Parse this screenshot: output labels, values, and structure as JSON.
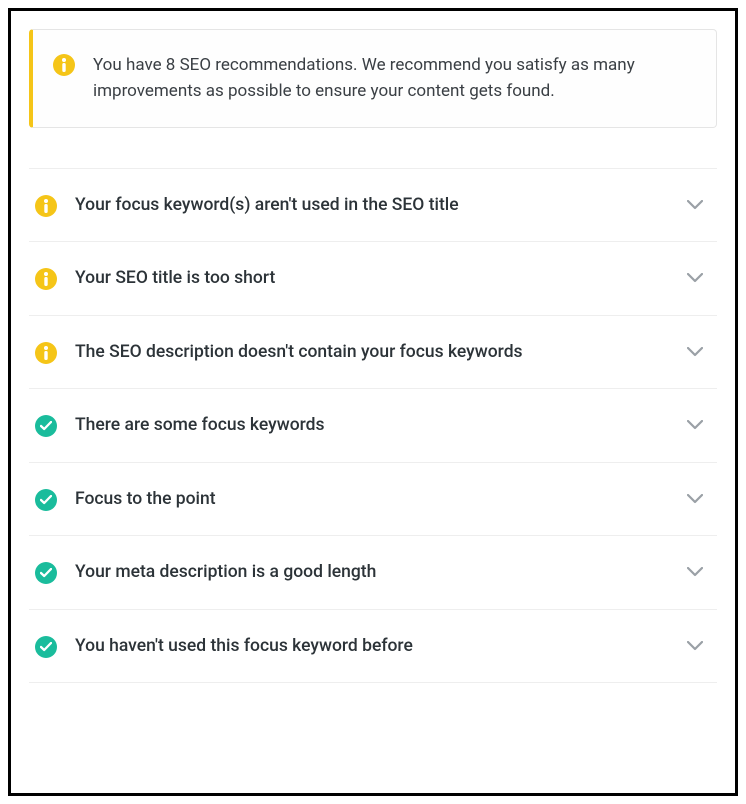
{
  "notice": {
    "text": "You have 8 SEO recommendations. We recommend you satisfy as many improvements as possible to ensure your content gets found."
  },
  "items": [
    {
      "status": "warning",
      "label": "Your focus keyword(s) aren't used in the SEO title"
    },
    {
      "status": "warning",
      "label": "Your SEO title is too short"
    },
    {
      "status": "warning",
      "label": "The SEO description doesn't contain your focus keywords"
    },
    {
      "status": "success",
      "label": "There are some focus keywords"
    },
    {
      "status": "success",
      "label": "Focus to the point"
    },
    {
      "status": "success",
      "label": "Your meta description is a good length"
    },
    {
      "status": "success",
      "label": "You haven't used this focus keyword before"
    }
  ]
}
